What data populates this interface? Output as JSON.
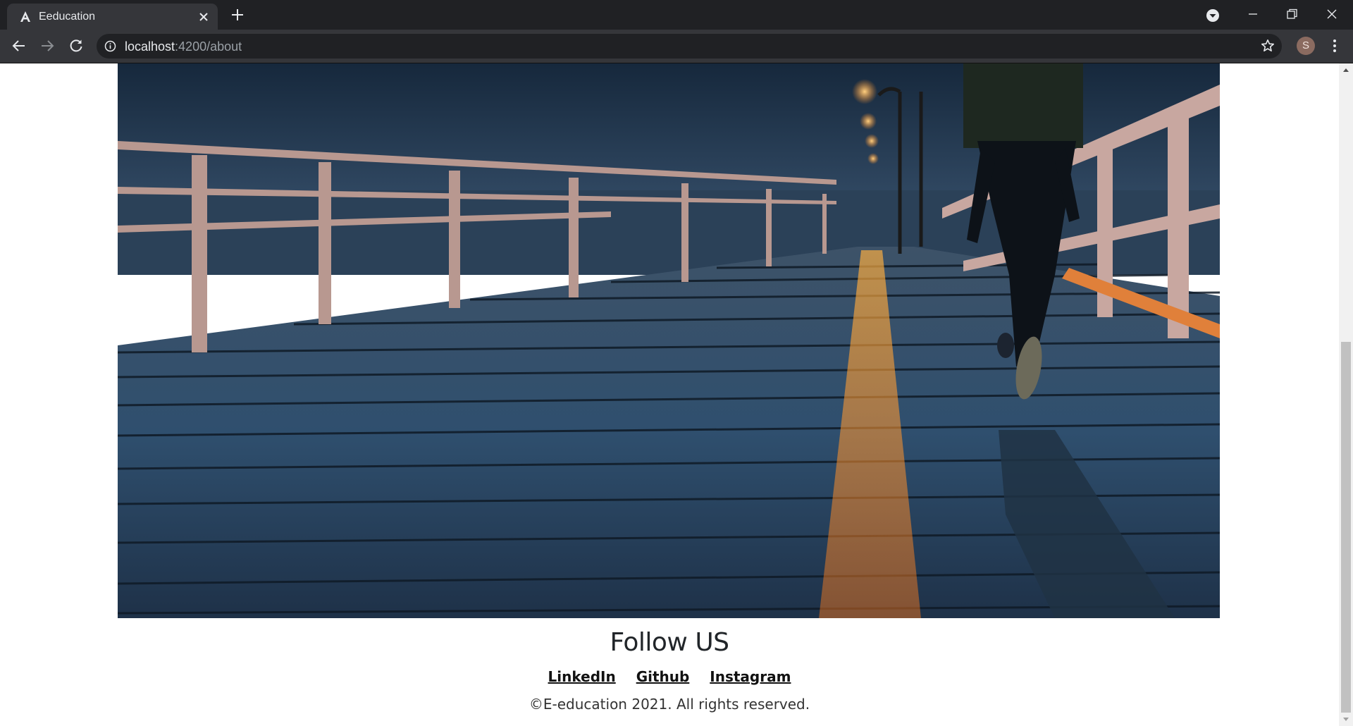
{
  "browser": {
    "tab_title": "Eeducation",
    "url_host": "localhost",
    "url_path": ":4200/about",
    "profile_initial": "S"
  },
  "colors": {
    "chrome_dark": "#202124",
    "chrome_toolbar": "#35363a",
    "page_background": "#ffffff",
    "heading_text": "#212529",
    "link_text": "#111111"
  },
  "icons": {
    "tab_favicon": "angular-icon",
    "tab_close": "close-icon",
    "new_tab": "plus-icon",
    "tab_search": "chevron-down-circle-icon",
    "back": "arrow-left-icon",
    "forward": "arrow-right-icon",
    "reload": "reload-icon",
    "site_info": "info-icon",
    "bookmark": "star-icon",
    "menu": "more-vertical-icon"
  },
  "hero": {
    "description_image": "night-boardwalk-photo"
  },
  "footer": {
    "title": "Follow US",
    "links": [
      "LinkedIn",
      "Github",
      "Instagram"
    ],
    "copyright": "©E-education 2021. All rights reserved."
  }
}
